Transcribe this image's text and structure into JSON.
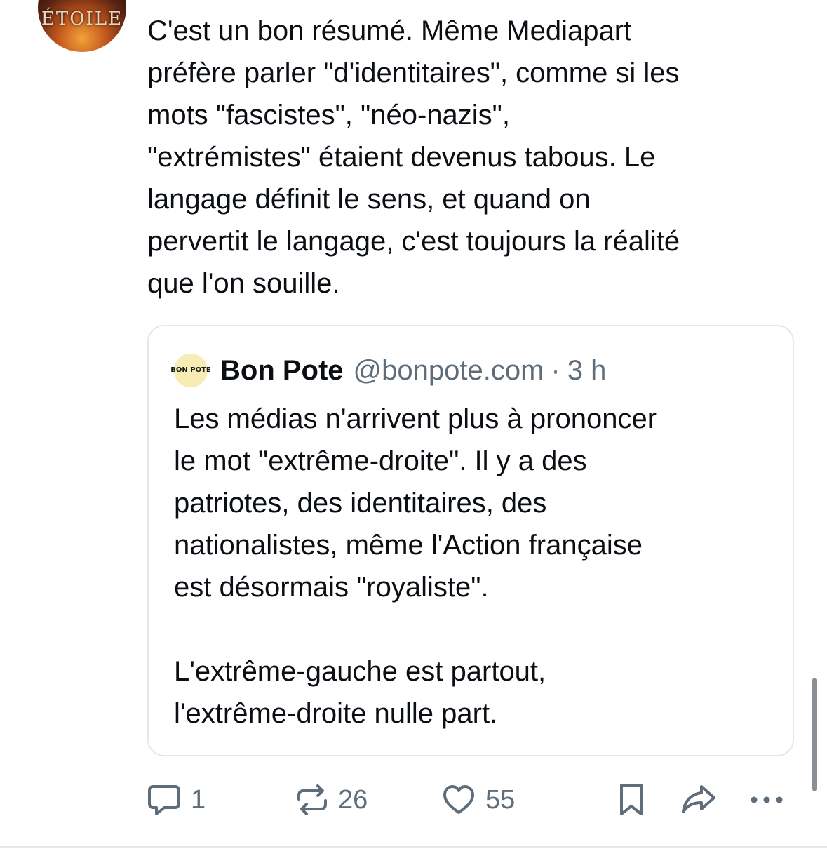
{
  "post": {
    "author_avatar_text": "ÉTOILE",
    "text": "C'est un bon résumé. Même Mediapart\npréfère parler \"d'identitaires\", comme si les\nmots \"fascistes\", \"néo-nazis\",\n\"extrémistes\" étaient devenus tabous. Le\nlangage définit le sens, et quand on\npervertit le langage, c'est toujours la réalité\nque l'on souille."
  },
  "quote": {
    "avatar_text": "BON POTE",
    "display_name": "Bon Pote",
    "handle": "@bonpote.com",
    "separator": "·",
    "time": "3 h",
    "text": "Les médias n'arrivent plus à prononcer\nle mot \"extrême-droite\". Il y a des\npatriotes, des identitaires, des\nnationalistes, même l'Action française\nest désormais \"royaliste\".\n\nL'extrême-gauche est partout,\nl'extrême-droite nulle part."
  },
  "actions": {
    "reply_count": "1",
    "repost_count": "26",
    "like_count": "55",
    "icons": [
      "reply-icon",
      "repost-icon",
      "like-icon",
      "bookmark-icon",
      "share-icon",
      "more-icon"
    ]
  },
  "colors": {
    "text": "#0b0f14",
    "secondary": "#5f6d7b",
    "border": "#e4e8ec"
  }
}
